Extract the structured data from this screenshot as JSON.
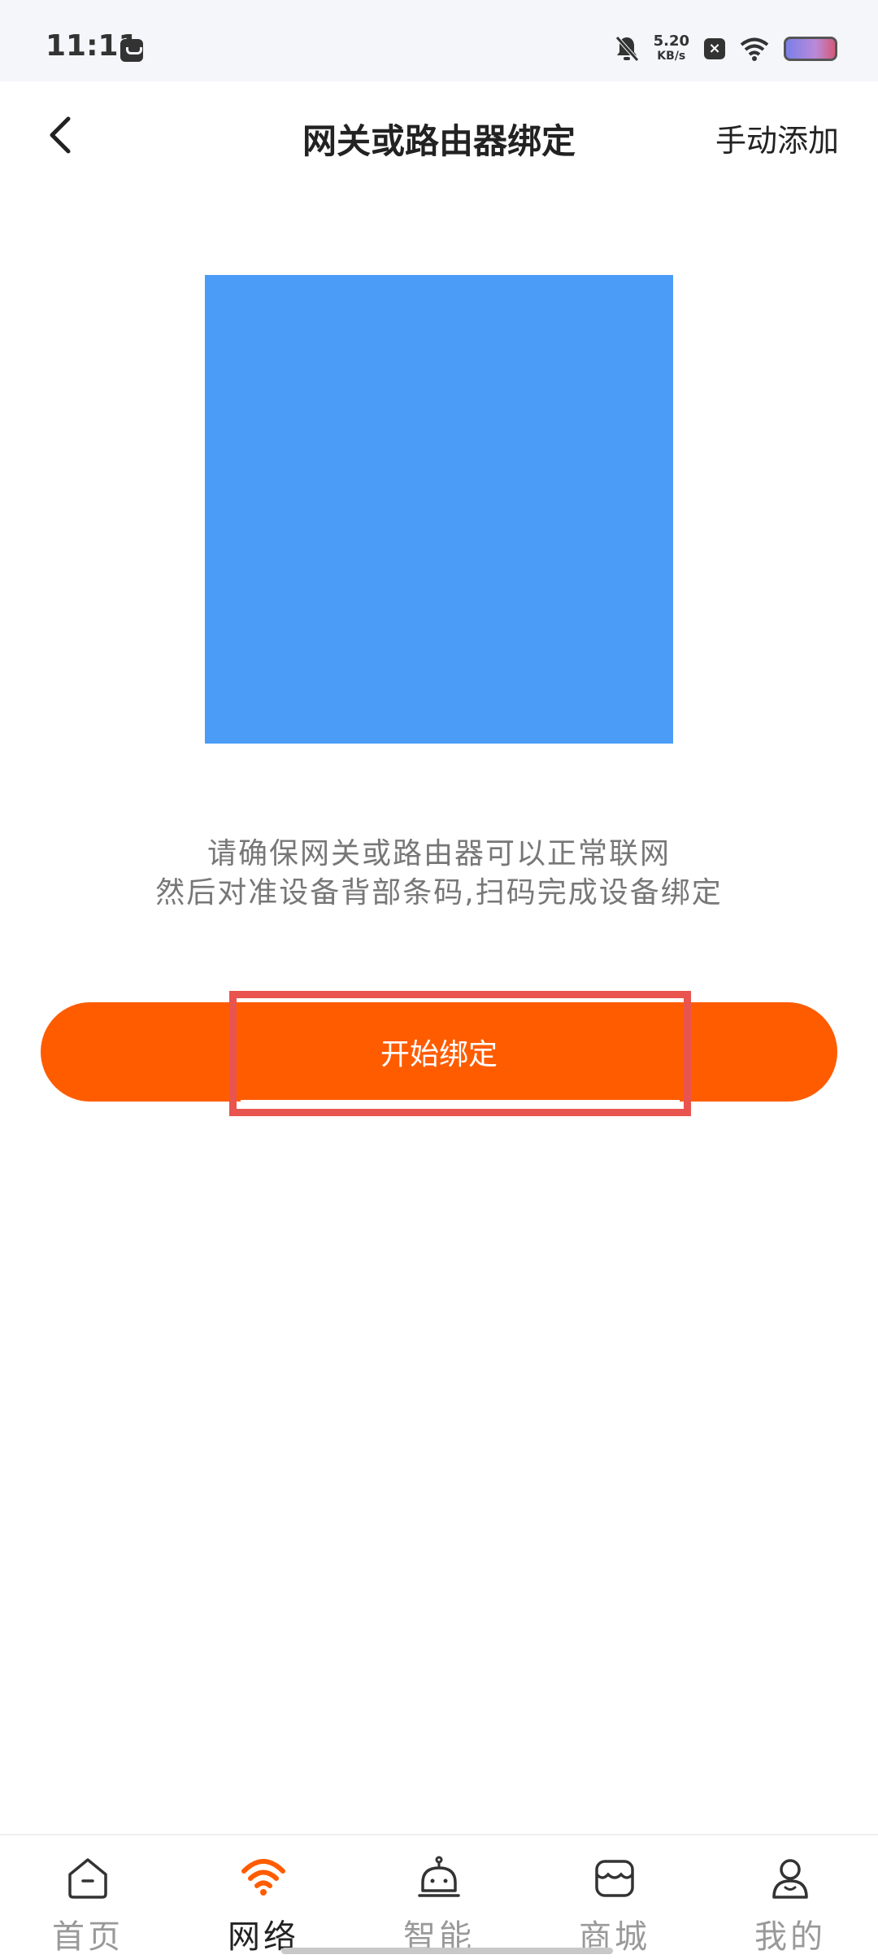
{
  "status_bar": {
    "time": "11:11",
    "net_speed_value": "5.20",
    "net_speed_unit": "KB/s",
    "x_badge": "×"
  },
  "header": {
    "title": "网关或路由器绑定",
    "manual_add": "手动添加"
  },
  "instructions": {
    "line1": "请确保网关或路由器可以正常联网",
    "line2": "然后对准设备背部条码,扫码完成设备绑定"
  },
  "start_button": {
    "label": "开始绑定",
    "color": "#ff5c00"
  },
  "placeholder_color": "#4a9cf6",
  "nav": {
    "items": [
      {
        "label": "首页",
        "icon": "home-icon"
      },
      {
        "label": "网络",
        "icon": "wifi-icon",
        "active": true
      },
      {
        "label": "智能",
        "icon": "robot-icon"
      },
      {
        "label": "商城",
        "icon": "store-icon"
      },
      {
        "label": "我的",
        "icon": "user-icon"
      }
    ]
  }
}
